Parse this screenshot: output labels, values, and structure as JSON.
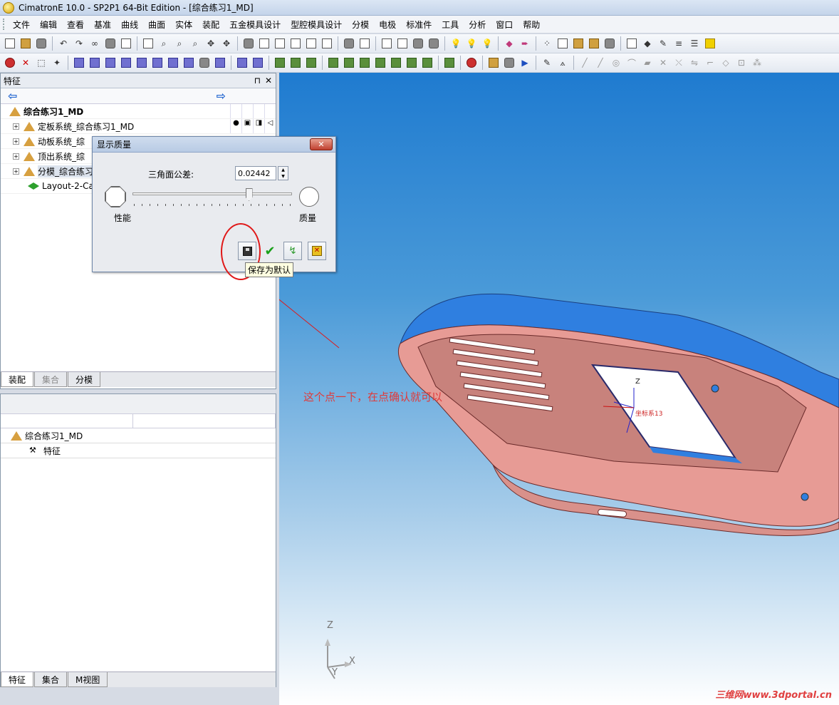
{
  "window": {
    "title": "CimatronE 10.0 - SP2P1 64-Bit Edition - [综合练习1_MD]"
  },
  "menu": [
    "文件",
    "编辑",
    "查看",
    "基准",
    "曲线",
    "曲面",
    "实体",
    "装配",
    "五金模具设计",
    "型腔模具设计",
    "分模",
    "电极",
    "标准件",
    "工具",
    "分析",
    "窗口",
    "帮助"
  ],
  "feature_panel": {
    "title": "特征",
    "pin": "⊓",
    "close": "✕",
    "tree": {
      "root": "综合练习1_MD",
      "children": [
        "定板系统_综合练习1_MD",
        "动板系统_综",
        "顶出系统_综",
        "分模_综合练习",
        "Layout-2-Ca"
      ]
    },
    "tabs": [
      "装配",
      "集合",
      "分模"
    ]
  },
  "bottom_panel": {
    "tree": {
      "root": "综合练习1_MD",
      "child": "特征"
    },
    "tabs": [
      "特征",
      "集合",
      "M视图"
    ]
  },
  "dialog": {
    "title": "显示质量",
    "close_label": "✕",
    "tolerance_label": "三角面公差:",
    "tolerance_value": "0.02442",
    "left_label": "性能",
    "right_label": "质量",
    "slider_fraction": 0.73,
    "tooltip": "保存为默认"
  },
  "viewport": {
    "annotation": "这个点一下，在点确认就可以",
    "csys_label": "坐标系13",
    "axes": {
      "z": "Z",
      "x": "X",
      "y": "Y"
    },
    "watermark": "三维网www.3dportal.cn"
  },
  "colors": {
    "viewport_top": "#1f7bd0",
    "part_blue": "#2f7fe0",
    "part_pink": "#e79b95",
    "annotation_red": "#e01818"
  }
}
